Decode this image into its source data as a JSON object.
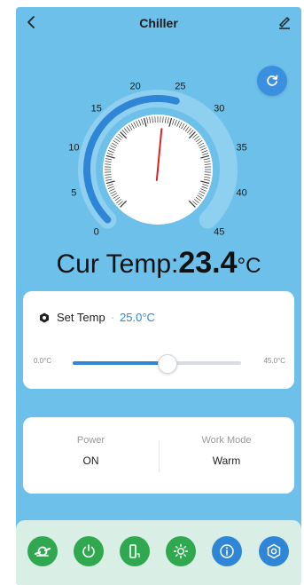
{
  "header": {
    "title": "Chiller"
  },
  "gauge": {
    "current_value": 23.4,
    "min": 0,
    "max": 45,
    "set_value": 25.0,
    "ticks": [
      "0",
      "5",
      "10",
      "15",
      "20",
      "25",
      "30",
      "35",
      "40",
      "45"
    ]
  },
  "current_temp": {
    "label": "Cur Temp:",
    "value": "23.4",
    "unit": "°C"
  },
  "set_temp": {
    "label": "Set Temp",
    "separator": "·",
    "value": "25.0°C",
    "slider_min_label": "0.0°C",
    "slider_max_label": "45.0°C",
    "fraction": 0.556
  },
  "status": {
    "power_label": "Power",
    "power_value": "ON",
    "mode_label": "Work Mode",
    "mode_value": "Warm"
  },
  "bottom_bar": {
    "buttons": [
      {
        "name": "pump-button",
        "icon": "pump-icon",
        "color": "#2fa84f"
      },
      {
        "name": "power-button",
        "icon": "power-icon",
        "color": "#2fa84f"
      },
      {
        "name": "level-button",
        "icon": "level-icon",
        "color": "#2fa84f"
      },
      {
        "name": "light-button",
        "icon": "sun-icon",
        "color": "#2fa84f"
      },
      {
        "name": "info-button",
        "icon": "info-icon",
        "color": "#2f86d6"
      },
      {
        "name": "settings-button",
        "icon": "gear-icon",
        "color": "#2f86d6"
      }
    ]
  },
  "colors": {
    "background": "#6cc0ea",
    "accent": "#2f86d6",
    "green": "#2fa84f",
    "needle": "#e02020"
  }
}
